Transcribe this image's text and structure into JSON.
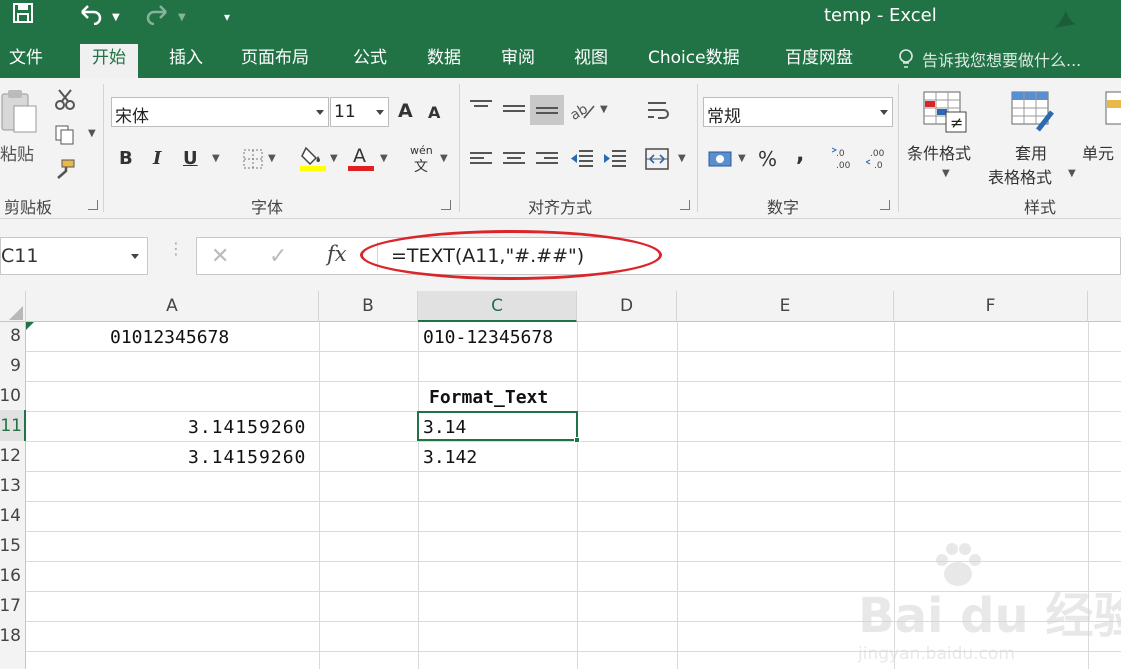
{
  "window": {
    "title": "temp - Excel"
  },
  "quick_access": {
    "save_icon": "save-icon",
    "undo_icon": "undo-icon",
    "redo_icon": "redo-icon",
    "customize_icon": "customize-icon"
  },
  "tabs": [
    {
      "label": "文件",
      "active": false
    },
    {
      "label": "开始",
      "active": true
    },
    {
      "label": "插入",
      "active": false
    },
    {
      "label": "页面布局",
      "active": false
    },
    {
      "label": "公式",
      "active": false
    },
    {
      "label": "数据",
      "active": false
    },
    {
      "label": "审阅",
      "active": false
    },
    {
      "label": "视图",
      "active": false
    },
    {
      "label": "Choice数据",
      "active": false
    },
    {
      "label": "百度网盘",
      "active": false
    }
  ],
  "tell_me": "告诉我您想要做什么...",
  "ribbon": {
    "clipboard": {
      "label": "剪贴板",
      "paste": "粘贴"
    },
    "font": {
      "label": "字体",
      "name": "宋体",
      "size": "11",
      "grow": "A",
      "shrink": "A",
      "bold": "B",
      "italic": "I",
      "underline": "U",
      "phonetic": "wén"
    },
    "alignment": {
      "label": "对齐方式"
    },
    "number": {
      "label": "数字",
      "format": "常规",
      "percent": "%",
      "comma": ","
    },
    "styles": {
      "label": "样式",
      "conditional": "条件格式",
      "table_line1": "套用",
      "table_line2": "表格格式",
      "cell": "单元"
    }
  },
  "formula_bar": {
    "name_box": "C11",
    "fx": "fx",
    "formula": "=TEXT(A11,\"#.##\")"
  },
  "columns": [
    "A",
    "B",
    "C",
    "D",
    "E",
    "F"
  ],
  "selected_column": "C",
  "rows": [
    "8",
    "9",
    "10",
    "11",
    "12",
    "13",
    "14",
    "15",
    "16",
    "17",
    "18"
  ],
  "selected_row": "11",
  "cells": {
    "A8": "01012345678",
    "C8": "010-12345678",
    "C10": "Format_Text",
    "A11": "3.14159260",
    "C11": "3.14",
    "A12": "3.14159260",
    "C12": "3.142"
  },
  "watermark": {
    "text": "Bai du 经验",
    "sub": "jingyan.baidu.com"
  },
  "colors": {
    "excel_green": "#217346",
    "annotation_red": "#d9262a"
  }
}
